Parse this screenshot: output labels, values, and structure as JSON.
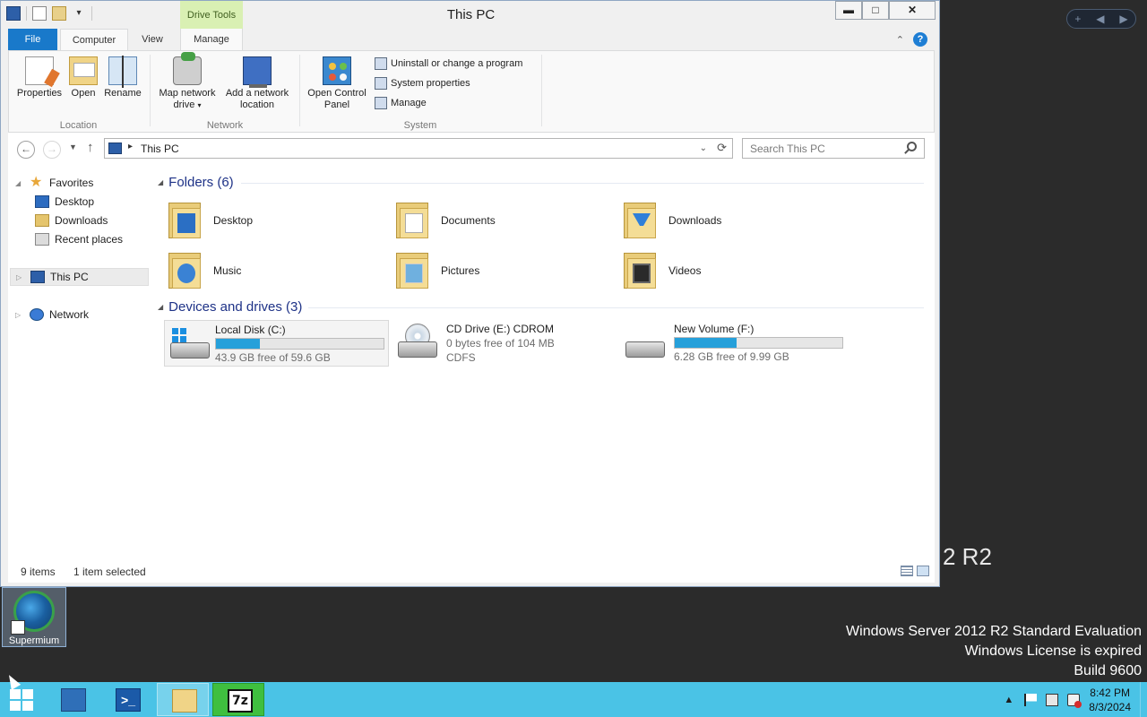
{
  "window": {
    "title": "This PC",
    "contextual_tab": "Drive Tools",
    "controls": {
      "minimize": "▬",
      "maximize": "□",
      "close": "✕"
    }
  },
  "ribbon": {
    "tabs": [
      {
        "label": "File"
      },
      {
        "label": "Computer"
      },
      {
        "label": "View"
      },
      {
        "label": "Manage"
      }
    ],
    "active_tab": "Computer",
    "groups": {
      "location": {
        "name": "Location",
        "buttons": [
          "Properties",
          "Open",
          "Rename"
        ]
      },
      "network": {
        "name": "Network",
        "map_drive_line1": "Map network",
        "map_drive_line2": "drive",
        "add_location_line1": "Add a network",
        "add_location_line2": "location"
      },
      "system": {
        "name": "System",
        "open_cp_line1": "Open Control",
        "open_cp_line2": "Panel",
        "small_buttons": [
          "Uninstall or change a program",
          "System properties",
          "Manage"
        ]
      }
    }
  },
  "address_bar": {
    "path": "This PC",
    "search_placeholder": "Search This PC"
  },
  "nav_pane": {
    "favorites": "Favorites",
    "items": [
      "Desktop",
      "Downloads",
      "Recent places"
    ],
    "this_pc": "This PC",
    "network": "Network"
  },
  "folders": {
    "header": "Folders (6)",
    "items": [
      {
        "name": "Desktop",
        "icon": "desktop-folder-icon"
      },
      {
        "name": "Documents",
        "icon": "documents-folder-icon"
      },
      {
        "name": "Downloads",
        "icon": "downloads-folder-icon"
      },
      {
        "name": "Music",
        "icon": "music-folder-icon"
      },
      {
        "name": "Pictures",
        "icon": "pictures-folder-icon"
      },
      {
        "name": "Videos",
        "icon": "videos-folder-icon"
      }
    ]
  },
  "devices": {
    "header": "Devices and drives (3)",
    "items": [
      {
        "name": "Local Disk (C:)",
        "free": "43.9 GB free of 59.6 GB",
        "used_fraction": 0.263,
        "selected": true
      },
      {
        "name": "CD Drive (E:) CDROM",
        "free": "0 bytes free of 104 MB",
        "fs": "CDFS"
      },
      {
        "name": "New Volume (F:)",
        "free": "6.28 GB free of 9.99 GB",
        "used_fraction": 0.371
      }
    ]
  },
  "status": {
    "items": "9 items",
    "selected": "1 item selected"
  },
  "desktop": {
    "icon_label": "Supermium",
    "watermark_partial": "2 R2",
    "watermark_lines": [
      "Windows Server 2012 R2 Standard Evaluation",
      "Windows License is expired",
      "Build 9600"
    ],
    "nav_buttons": [
      "+",
      "◀",
      "▶"
    ]
  },
  "taskbar": {
    "time": "8:42 PM",
    "date": "8/3/2024",
    "powershell_glyph": ">_",
    "sevenzip_glyph": "7z",
    "tray_arrow": "▲"
  },
  "colors": {
    "ribbon_file_tab": "#1979ca",
    "drive_bar_fill": "#26a0da",
    "taskbar": "#4ac3e6",
    "drive_tools_tab": "#d9f0b3"
  }
}
